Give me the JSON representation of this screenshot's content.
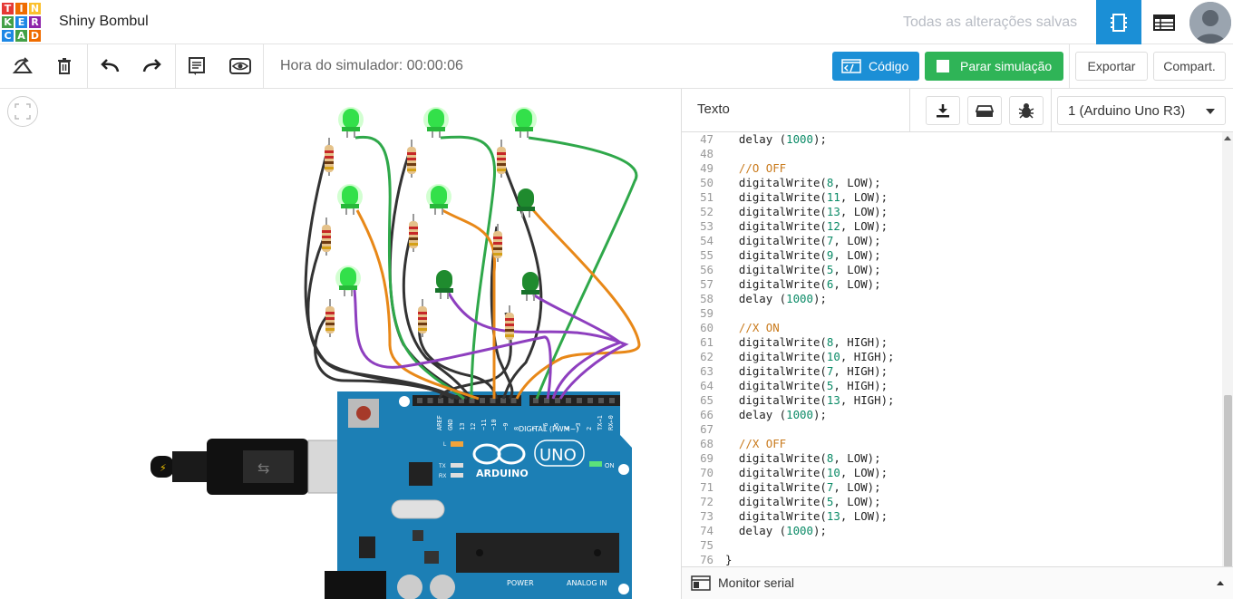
{
  "app": {
    "logo_letters": [
      "T",
      "I",
      "N",
      "K",
      "E",
      "R",
      "C",
      "A",
      "D"
    ],
    "logo_colors": [
      "#e53935",
      "#ef6c00",
      "#fbc02d",
      "#43a047",
      "#1e88e5",
      "#8e24aa",
      "#1e88e5",
      "#43a047",
      "#ef6c00"
    ],
    "project_title": "Shiny Bombul",
    "save_status": "Todas as alterações salvas"
  },
  "toolbar": {
    "sim_time": "Hora do simulador: 00:00:06",
    "code_label": "Código",
    "stop_sim_label": "Parar simulação",
    "export_label": "Exportar",
    "share_label": "Compart."
  },
  "panel": {
    "mode_label": "Texto",
    "board_select": "1 (Arduino Uno R3)",
    "serial_monitor": "Monitor serial"
  },
  "code_lines": [
    {
      "n": "47",
      "t": "  delay (1000);"
    },
    {
      "n": "48",
      "t": ""
    },
    {
      "n": "49",
      "t": "  //O OFF",
      "c": true
    },
    {
      "n": "50",
      "t": "  digitalWrite(8, LOW);"
    },
    {
      "n": "51",
      "t": "  digitalWrite(11, LOW);"
    },
    {
      "n": "52",
      "t": "  digitalWrite(13, LOW);"
    },
    {
      "n": "53",
      "t": "  digitalWrite(12, LOW);"
    },
    {
      "n": "54",
      "t": "  digitalWrite(7, LOW);"
    },
    {
      "n": "55",
      "t": "  digitalWrite(9, LOW);"
    },
    {
      "n": "56",
      "t": "  digitalWrite(5, LOW);"
    },
    {
      "n": "57",
      "t": "  digitalWrite(6, LOW);"
    },
    {
      "n": "58",
      "t": "  delay (1000);"
    },
    {
      "n": "59",
      "t": ""
    },
    {
      "n": "60",
      "t": "  //X ON",
      "c": true
    },
    {
      "n": "61",
      "t": "  digitalWrite(8, HIGH);"
    },
    {
      "n": "62",
      "t": "  digitalWrite(10, HIGH);"
    },
    {
      "n": "63",
      "t": "  digitalWrite(7, HIGH);"
    },
    {
      "n": "64",
      "t": "  digitalWrite(5, HIGH);"
    },
    {
      "n": "65",
      "t": "  digitalWrite(13, HIGH);"
    },
    {
      "n": "66",
      "t": "  delay (1000);"
    },
    {
      "n": "67",
      "t": ""
    },
    {
      "n": "68",
      "t": "  //X OFF",
      "c": true
    },
    {
      "n": "69",
      "t": "  digitalWrite(8, LOW);"
    },
    {
      "n": "70",
      "t": "  digitalWrite(10, LOW);"
    },
    {
      "n": "71",
      "t": "  digitalWrite(7, LOW);"
    },
    {
      "n": "72",
      "t": "  digitalWrite(5, LOW);"
    },
    {
      "n": "73",
      "t": "  digitalWrite(13, LOW);"
    },
    {
      "n": "74",
      "t": "  delay (1000);"
    },
    {
      "n": "75",
      "t": ""
    },
    {
      "n": "76",
      "t": "}"
    }
  ],
  "board": {
    "brand": "ARDUINO",
    "model": "UNO",
    "digital_label": "DIGITAL (PWM~)",
    "power_label": "POWER",
    "analog_label": "ANALOG IN",
    "on_label": "ON",
    "tx_label": "TX",
    "rx_label": "RX",
    "l_label": "L",
    "pin_labels": [
      "AREF",
      "GND",
      "13",
      "12",
      "~11",
      "~10",
      "~9",
      "8",
      "7",
      "~6",
      "~5",
      "4",
      "~3",
      "2",
      "TX→1",
      "RX←0"
    ]
  },
  "leds": [
    {
      "state": "on"
    },
    {
      "state": "on"
    },
    {
      "state": "on"
    },
    {
      "state": "on"
    },
    {
      "state": "on"
    },
    {
      "state": "off"
    },
    {
      "state": "on"
    },
    {
      "state": "off"
    },
    {
      "state": "off"
    }
  ]
}
